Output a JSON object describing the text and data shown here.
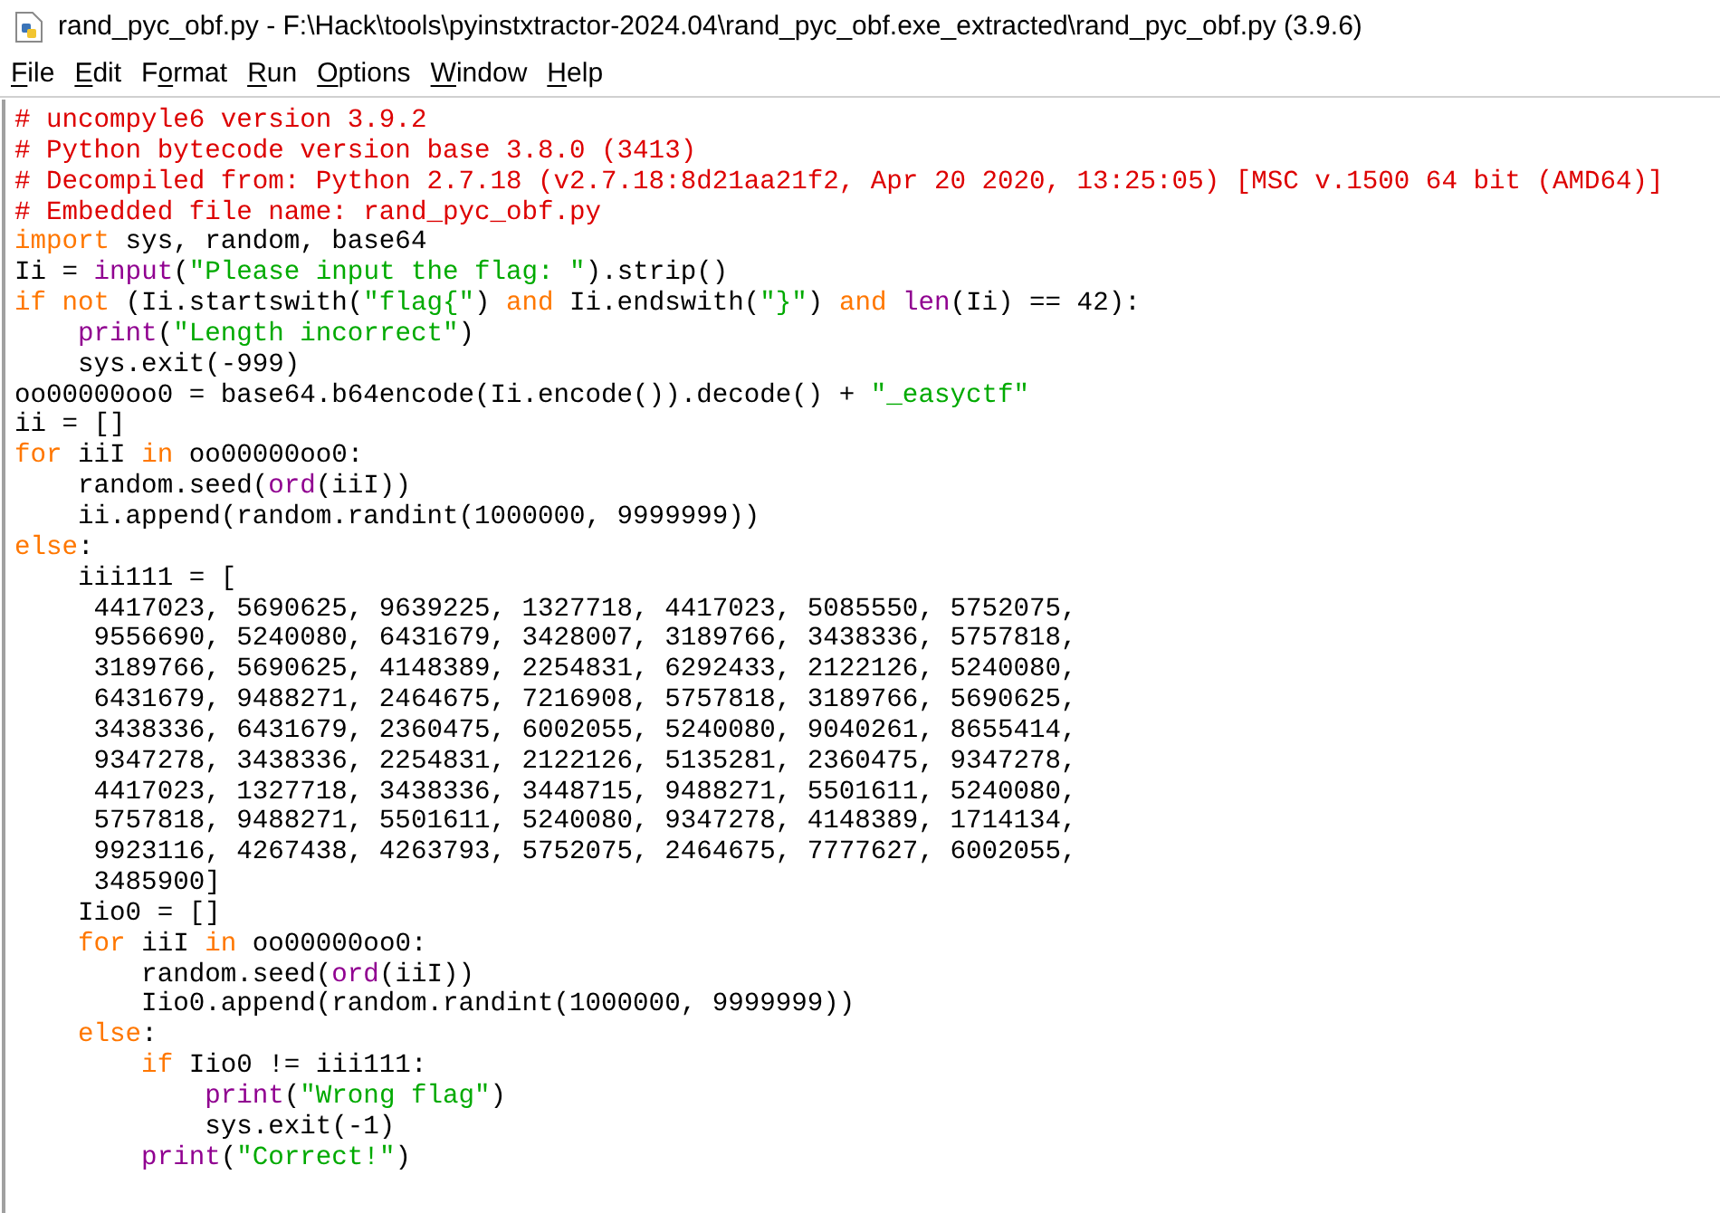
{
  "window": {
    "title": "rand_pyc_obf.py - F:\\Hack\\tools\\pyinstxtractor-2024.04\\rand_pyc_obf.exe_extracted\\rand_pyc_obf.py (3.9.6)"
  },
  "menu": [
    {
      "mnemonic": "F",
      "rest": "ile"
    },
    {
      "mnemonic": "E",
      "rest": "dit"
    },
    {
      "prefix": "F",
      "mnemonic": "o",
      "rest": "rmat"
    },
    {
      "mnemonic": "R",
      "rest": "un"
    },
    {
      "mnemonic": "O",
      "rest": "ptions"
    },
    {
      "mnemonic": "W",
      "rest": "indow"
    },
    {
      "mnemonic": "H",
      "rest": "elp"
    }
  ],
  "code_lines": [
    [
      {
        "kind": "comment",
        "text": "# uncompyle6 version 3.9.2"
      }
    ],
    [
      {
        "kind": "comment",
        "text": "# Python bytecode version base 3.8.0 (3413)"
      }
    ],
    [
      {
        "kind": "comment",
        "text": "# Decompiled from: Python 2.7.18 (v2.7.18:8d21aa21f2, Apr 20 2020, 13:25:05) [MSC v.1500 64 bit (AMD64)]"
      }
    ],
    [
      {
        "kind": "comment",
        "text": "# Embedded file name: rand_pyc_obf.py"
      }
    ],
    [
      {
        "kind": "keyword",
        "text": "import"
      },
      {
        "kind": "plain",
        "text": " sys, random, base64"
      }
    ],
    [
      {
        "kind": "plain",
        "text": "Ii = "
      },
      {
        "kind": "builtin",
        "text": "input"
      },
      {
        "kind": "plain",
        "text": "("
      },
      {
        "kind": "string",
        "text": "\"Please input the flag: \""
      },
      {
        "kind": "plain",
        "text": ").strip()"
      }
    ],
    [
      {
        "kind": "keyword",
        "text": "if not"
      },
      {
        "kind": "plain",
        "text": " (Ii.startswith("
      },
      {
        "kind": "string",
        "text": "\"flag{\""
      },
      {
        "kind": "plain",
        "text": ") "
      },
      {
        "kind": "keyword",
        "text": "and"
      },
      {
        "kind": "plain",
        "text": " Ii.endswith("
      },
      {
        "kind": "string",
        "text": "\"}\""
      },
      {
        "kind": "plain",
        "text": ") "
      },
      {
        "kind": "keyword",
        "text": "and "
      },
      {
        "kind": "builtin",
        "text": "len"
      },
      {
        "kind": "plain",
        "text": "(Ii) == 42):"
      }
    ],
    [
      {
        "kind": "builtin",
        "text": "    print"
      },
      {
        "kind": "plain",
        "text": "("
      },
      {
        "kind": "string",
        "text": "\"Length incorrect\""
      },
      {
        "kind": "plain",
        "text": ")"
      }
    ],
    [
      {
        "kind": "plain",
        "text": "    sys.exit(-999)"
      }
    ],
    [
      {
        "kind": "plain",
        "text": "oo00000oo0 = base64.b64encode(Ii.encode()).decode() + "
      },
      {
        "kind": "string",
        "text": "\"_easyctf\""
      }
    ],
    [
      {
        "kind": "plain",
        "text": "ii = []"
      }
    ],
    [
      {
        "kind": "keyword",
        "text": "for"
      },
      {
        "kind": "plain",
        "text": " iiI "
      },
      {
        "kind": "keyword",
        "text": "in"
      },
      {
        "kind": "plain",
        "text": " oo00000oo0:"
      }
    ],
    [
      {
        "kind": "plain",
        "text": "    random.seed("
      },
      {
        "kind": "builtin",
        "text": "ord"
      },
      {
        "kind": "plain",
        "text": "(iiI))"
      }
    ],
    [
      {
        "kind": "plain",
        "text": "    ii.append(random.randint(1000000, 9999999))"
      }
    ],
    [
      {
        "kind": "keyword",
        "text": "else"
      },
      {
        "kind": "plain",
        "text": ":"
      }
    ],
    [
      {
        "kind": "plain",
        "text": "    iii111 = ["
      }
    ],
    [
      {
        "kind": "plain",
        "text": "     4417023, 5690625, 9639225, 1327718, 4417023, 5085550, 5752075,"
      }
    ],
    [
      {
        "kind": "plain",
        "text": "     9556690, 5240080, 6431679, 3428007, 3189766, 3438336, 5757818,"
      }
    ],
    [
      {
        "kind": "plain",
        "text": "     3189766, 5690625, 4148389, 2254831, 6292433, 2122126, 5240080,"
      }
    ],
    [
      {
        "kind": "plain",
        "text": "     6431679, 9488271, 2464675, 7216908, 5757818, 3189766, 5690625,"
      }
    ],
    [
      {
        "kind": "plain",
        "text": "     3438336, 6431679, 2360475, 6002055, 5240080, 9040261, 8655414,"
      }
    ],
    [
      {
        "kind": "plain",
        "text": "     9347278, 3438336, 2254831, 2122126, 5135281, 2360475, 9347278,"
      }
    ],
    [
      {
        "kind": "plain",
        "text": "     4417023, 1327718, 3438336, 3448715, 9488271, 5501611, 5240080,"
      }
    ],
    [
      {
        "kind": "plain",
        "text": "     5757818, 9488271, 5501611, 5240080, 9347278, 4148389, 1714134,"
      }
    ],
    [
      {
        "kind": "plain",
        "text": "     9923116, 4267438, 4263793, 5752075, 2464675, 7777627, 6002055,"
      }
    ],
    [
      {
        "kind": "plain",
        "text": "     3485900]"
      }
    ],
    [
      {
        "kind": "plain",
        "text": "    Iio0 = []"
      }
    ],
    [
      {
        "kind": "keyword",
        "text": "    for"
      },
      {
        "kind": "plain",
        "text": " iiI "
      },
      {
        "kind": "keyword",
        "text": "in"
      },
      {
        "kind": "plain",
        "text": " oo00000oo0:"
      }
    ],
    [
      {
        "kind": "plain",
        "text": "        random.seed("
      },
      {
        "kind": "builtin",
        "text": "ord"
      },
      {
        "kind": "plain",
        "text": "(iiI))"
      }
    ],
    [
      {
        "kind": "plain",
        "text": "        Iio0.append(random.randint(1000000, 9999999))"
      }
    ],
    [
      {
        "kind": "keyword",
        "text": "    else"
      },
      {
        "kind": "plain",
        "text": ":"
      }
    ],
    [
      {
        "kind": "keyword",
        "text": "        if"
      },
      {
        "kind": "plain",
        "text": " Iio0 != iii111:"
      }
    ],
    [
      {
        "kind": "builtin",
        "text": "            print"
      },
      {
        "kind": "plain",
        "text": "("
      },
      {
        "kind": "string",
        "text": "\"Wrong flag\""
      },
      {
        "kind": "plain",
        "text": ")"
      }
    ],
    [
      {
        "kind": "plain",
        "text": "            sys.exit(-1)"
      }
    ],
    [
      {
        "kind": "builtin",
        "text": "        print"
      },
      {
        "kind": "plain",
        "text": "("
      },
      {
        "kind": "string",
        "text": "\"Correct!\""
      },
      {
        "kind": "plain",
        "text": ")"
      }
    ]
  ]
}
